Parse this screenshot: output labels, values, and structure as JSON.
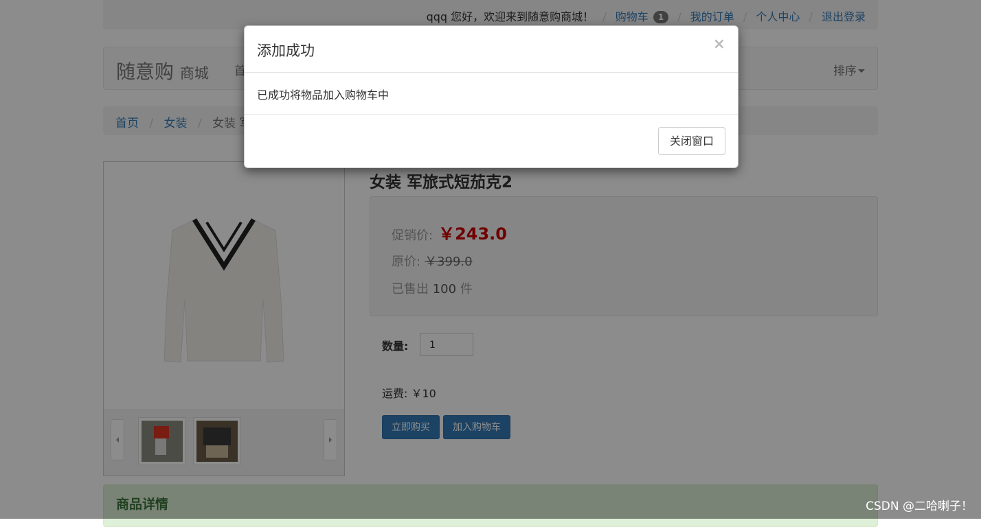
{
  "topbar": {
    "greeting": "qqq 您好，欢迎来到随意购商城！",
    "cart_label": "购物车",
    "cart_count": "1",
    "orders_label": "我的订单",
    "profile_label": "个人中心",
    "logout_label": "退出登录"
  },
  "navbar": {
    "brand": "随意购",
    "brand_sub": "商城",
    "first_item": "首",
    "sort_label": "排序"
  },
  "breadcrumb": {
    "home": "首页",
    "category": "女装",
    "current": "女装 军"
  },
  "product": {
    "title": "女装 军旅式短茄克2",
    "promo_label": "促销价:",
    "promo_price": "￥243.0",
    "orig_label": "原价:",
    "orig_price": "￥399.0",
    "sold_prefix": "已售出",
    "sold_count": "100",
    "sold_unit": "件",
    "qty_label": "数量:",
    "qty_value": "1",
    "shipping": "运费: ￥10",
    "buy_now": "立即购买",
    "add_cart": "加入购物车",
    "details_title": "商品详情"
  },
  "modal": {
    "title": "添加成功",
    "close_symbol": "×",
    "body": "已成功将物品加入购物车中",
    "close_button": "关闭窗口"
  },
  "watermark": "CSDN @二哈喇子！",
  "colors": {
    "link": "#337ab7",
    "price_red": "#cc0000",
    "primary_button": "#337ab7",
    "panel_green": "#dff0d8"
  }
}
